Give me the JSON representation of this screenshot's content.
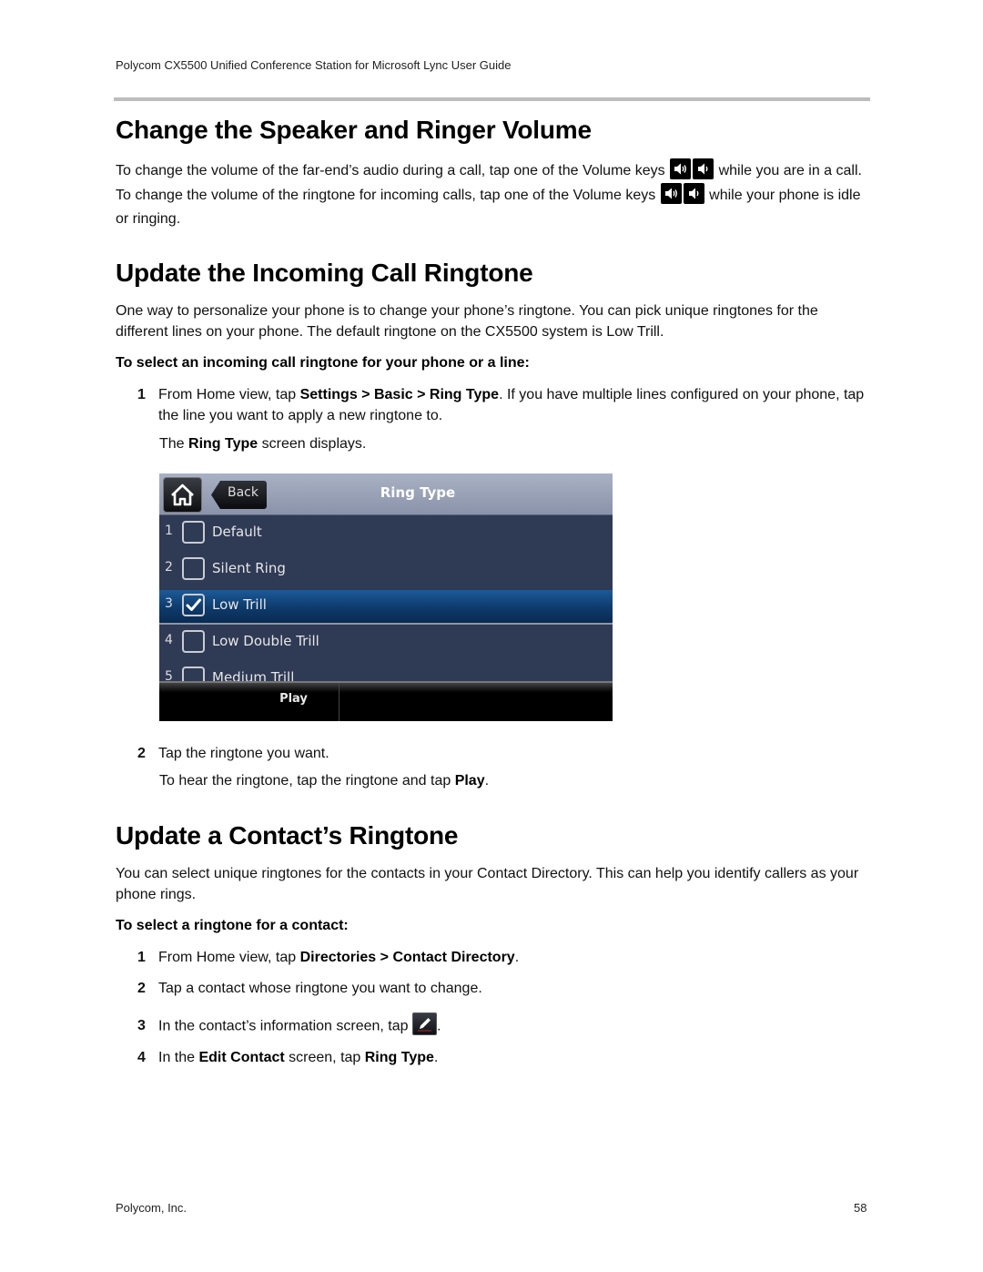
{
  "header": {
    "running_title": "Polycom CX5500 Unified Conference Station for Microsoft Lync User Guide"
  },
  "section_volume": {
    "title": "Change the Speaker and Ringer Volume",
    "para_part1": "To change the volume of the far-end’s audio during a call, tap one of the Volume keys",
    "para_part2": "while you are in a call. To change the volume of the ringtone for incoming calls, tap one of the Volume keys",
    "para_part3": "while your phone is idle or ringing.",
    "icons": [
      "volume-up-icon",
      "volume-down-icon"
    ]
  },
  "section_incoming": {
    "title": "Update the Incoming Call Ringtone",
    "para": "One way to personalize your phone is to change your phone’s ringtone. You can pick unique ringtones for the different lines on your phone. The default ringtone on the CX5500 system is Low Trill.",
    "procedure_title": "To select an incoming call ringtone for your phone or a line:",
    "step1": {
      "num": "1",
      "pre": "From Home view, tap ",
      "b1": "Settings",
      "sep1": " > ",
      "b2": "Basic",
      "sep2": " > ",
      "b3": "Ring Type",
      "post": ". If you have multiple lines configured on your phone, tap the line you want to apply a new ringtone to.",
      "result_pre": "The ",
      "result_bold": "Ring Type",
      "result_post": " screen displays."
    },
    "step2": {
      "num": "2",
      "text": "Tap the ringtone you want.",
      "sub_pre": "To hear the ringtone, tap the ringtone and tap ",
      "sub_bold": "Play",
      "sub_post": "."
    }
  },
  "phone_screen": {
    "back_label": "Back",
    "title": "Ring Type",
    "items": [
      {
        "num": "1",
        "label": "Default",
        "checked": false
      },
      {
        "num": "2",
        "label": "Silent Ring",
        "checked": false
      },
      {
        "num": "3",
        "label": "Low Trill",
        "checked": true
      },
      {
        "num": "4",
        "label": "Low Double Trill",
        "checked": false
      },
      {
        "num": "5",
        "label": "Medium Trill",
        "checked": false
      }
    ],
    "softkey_play": "Play",
    "colors": {
      "selected_row": "#1c5a98",
      "row_bg": "#2f3a55",
      "header_bg": "#a9b1c4"
    }
  },
  "section_contact": {
    "title": "Update a Contact’s Ringtone",
    "para": "You can select unique ringtones for the contacts in your Contact Directory. This can help you identify callers as your phone rings.",
    "procedure_title": "To select a ringtone for a contact:",
    "step1": {
      "num": "1",
      "pre": "From Home view, tap ",
      "b1": "Directories",
      "sep": " > ",
      "b2": "Contact Directory",
      "post": "."
    },
    "step2": {
      "num": "2",
      "text": "Tap a contact whose ringtone you want to change."
    },
    "step3": {
      "num": "3",
      "pre": "In the contact’s information screen, tap ",
      "post": ".",
      "icon": "edit-pencil-icon"
    },
    "step4": {
      "num": "4",
      "pre": "In the ",
      "b1": "Edit Contact",
      "mid": " screen, tap ",
      "b2": "Ring Type",
      "post": "."
    }
  },
  "footer": {
    "company": "Polycom, Inc.",
    "page_number": "58"
  }
}
